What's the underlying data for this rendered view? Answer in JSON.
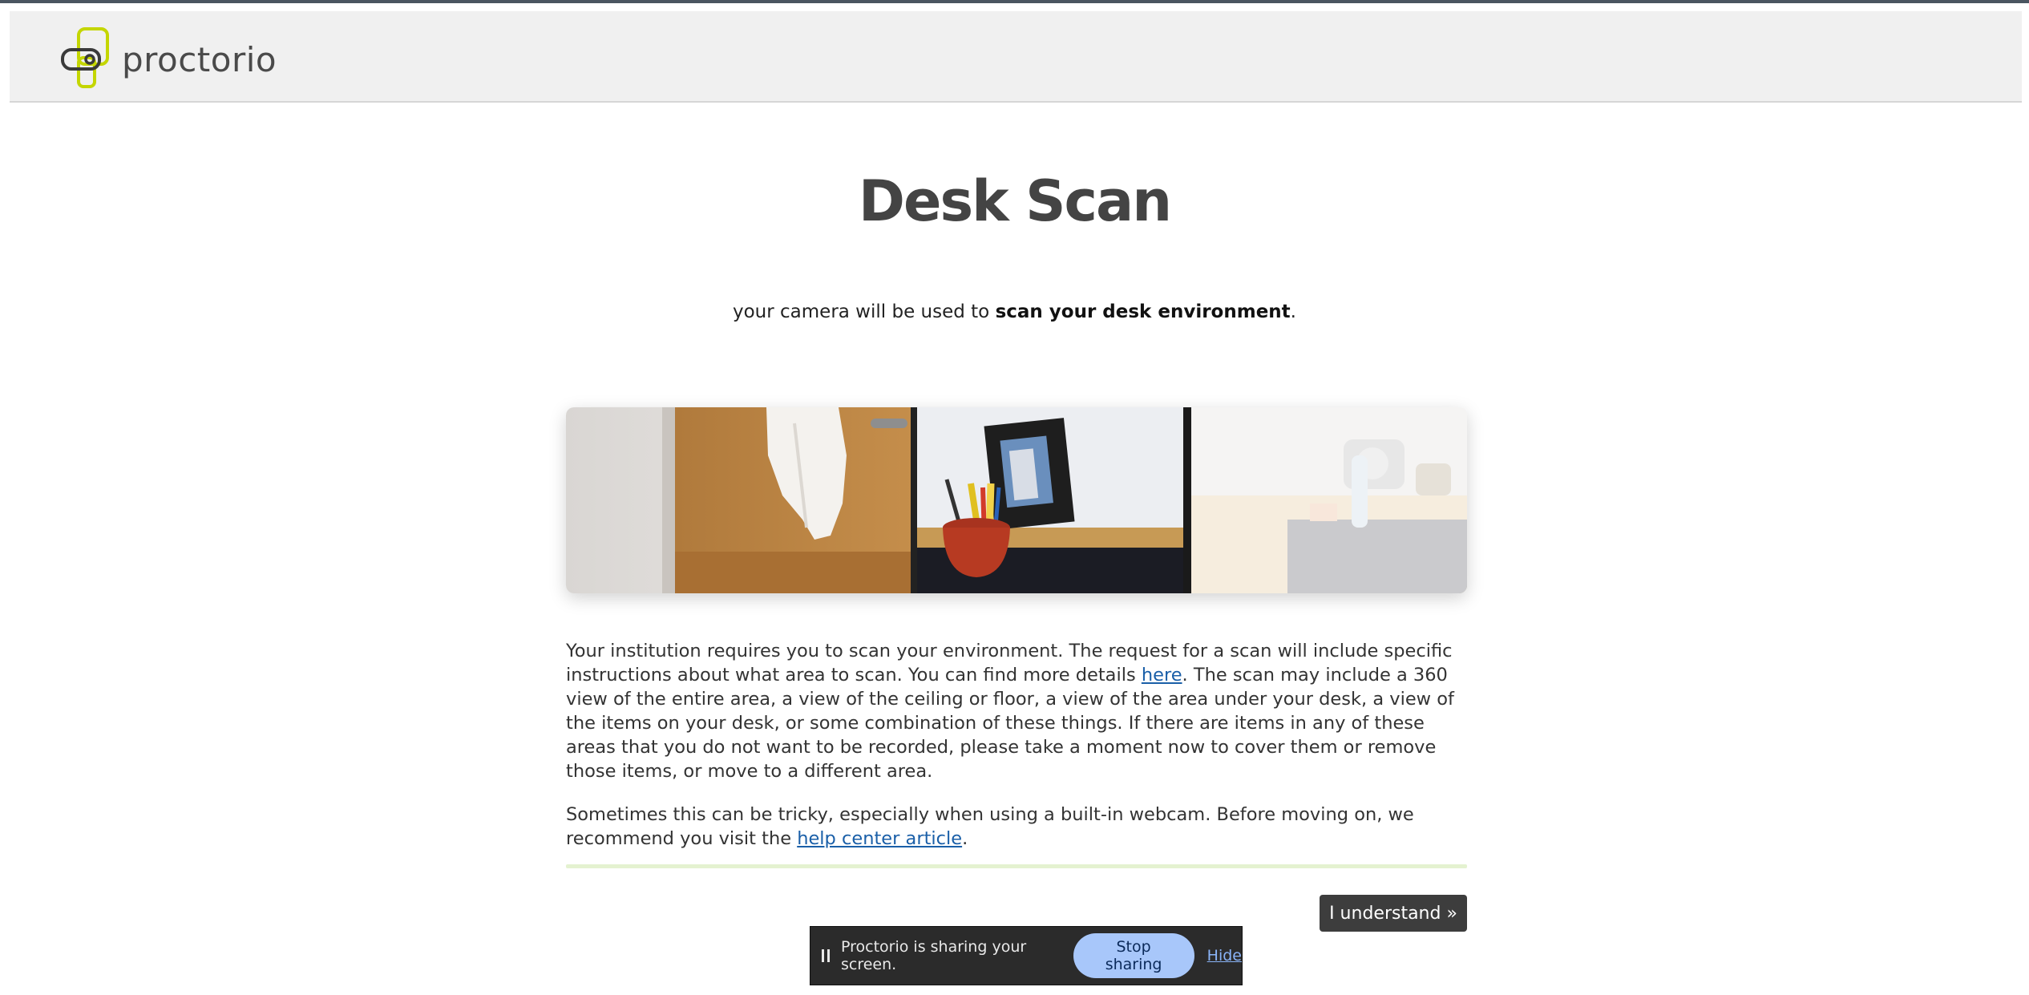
{
  "app": {
    "brand": "proctorio"
  },
  "page": {
    "title": "Desk Scan",
    "subtitle_prefix": "your camera will be used to ",
    "subtitle_bold": "scan your desk environment",
    "subtitle_suffix": "."
  },
  "content": {
    "paragraph1_part1": "Your institution requires you to scan your environment. The request for a scan will include specific instructions about what area to scan. You can find more details ",
    "paragraph1_link": "here",
    "paragraph1_part2": ". The scan may include a 360 view of the entire area, a view of the ceiling or floor, a view of the area under your desk, a view of the items on your desk, or some combination of these things. If there are items in any of these areas that you do not want to be recorded, please take a moment now to cover them or remove those items, or move to a different area.",
    "paragraph2_part1": "Sometimes this can be tricky, especially when using a built-in webcam. Before moving on, we recommend you visit the ",
    "paragraph2_link": "help center article",
    "paragraph2_part2": "."
  },
  "actions": {
    "understand_label": "I understand »"
  },
  "share_bar": {
    "message": "Proctorio is sharing your screen.",
    "stop_label": "Stop sharing",
    "hide_label": "Hide"
  },
  "colors": {
    "brand_green": "#c4d600",
    "button_dark": "#3d3d3d",
    "link_blue": "#1a5fa8",
    "stop_button": "#a8c7fa"
  },
  "icons": {
    "logo": "proctorio-logo-icon",
    "pause": "pause-icon"
  }
}
